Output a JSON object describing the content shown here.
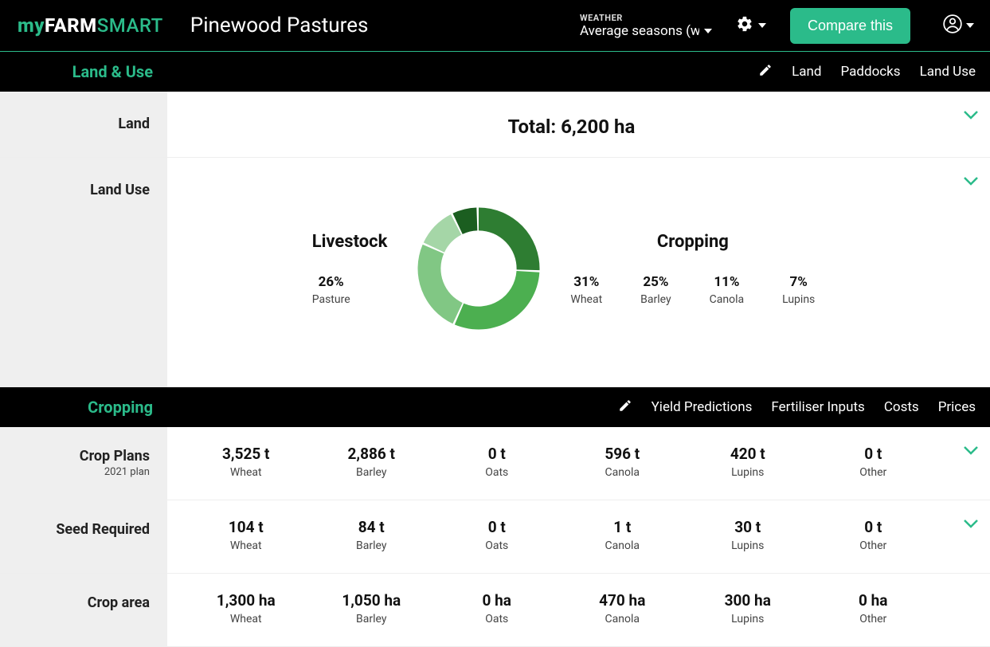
{
  "header": {
    "logo": {
      "my": "my",
      "farm": "FARM",
      "smart": "SMART"
    },
    "farm_name": "Pinewood Pastures",
    "weather_label": "WEATHER",
    "weather_value": "Average seasons (wa",
    "compare_label": "Compare this"
  },
  "section_landuse": {
    "title": "Land & Use",
    "tabs": [
      "Land",
      "Paddocks",
      "Land Use"
    ]
  },
  "land": {
    "label": "Land",
    "total_text": "Total: 6,200 ha"
  },
  "landuse": {
    "label": "Land Use",
    "livestock_title": "Livestock",
    "cropping_title": "Cropping",
    "livestock": [
      {
        "pct": "26%",
        "name": "Pasture"
      }
    ],
    "cropping": [
      {
        "pct": "31%",
        "name": "Wheat"
      },
      {
        "pct": "25%",
        "name": "Barley"
      },
      {
        "pct": "11%",
        "name": "Canola"
      },
      {
        "pct": "7%",
        "name": "Lupins"
      }
    ]
  },
  "chart_data": {
    "type": "pie",
    "title": "",
    "series": [
      {
        "name": "Pasture",
        "value": 26,
        "color": "#2e7d32"
      },
      {
        "name": "Wheat",
        "value": 31,
        "color": "#4caf50"
      },
      {
        "name": "Barley",
        "value": 25,
        "color": "#81c784"
      },
      {
        "name": "Canola",
        "value": 11,
        "color": "#a5d6a7"
      },
      {
        "name": "Lupins",
        "value": 7,
        "color": "#1b5e20"
      }
    ]
  },
  "section_cropping": {
    "title": "Cropping",
    "tabs": [
      "Yield Predictions",
      "Fertiliser Inputs",
      "Costs",
      "Prices"
    ]
  },
  "crop_labels": {
    "crop_plans": "Crop Plans",
    "crop_plans_sub": "2021 plan",
    "seed_required": "Seed Required",
    "crop_area": "Crop area"
  },
  "crop_columns": [
    "Wheat",
    "Barley",
    "Oats",
    "Canola",
    "Lupins",
    "Other"
  ],
  "crop_plans": [
    "3,525 t",
    "2,886 t",
    "0 t",
    "596 t",
    "420 t",
    "0 t"
  ],
  "seed_required": [
    "104 t",
    "84 t",
    "0 t",
    "1 t",
    "30 t",
    "0 t"
  ],
  "crop_area": [
    "1,300 ha",
    "1,050 ha",
    "0 ha",
    "470 ha",
    "300 ha",
    "0 ha"
  ]
}
